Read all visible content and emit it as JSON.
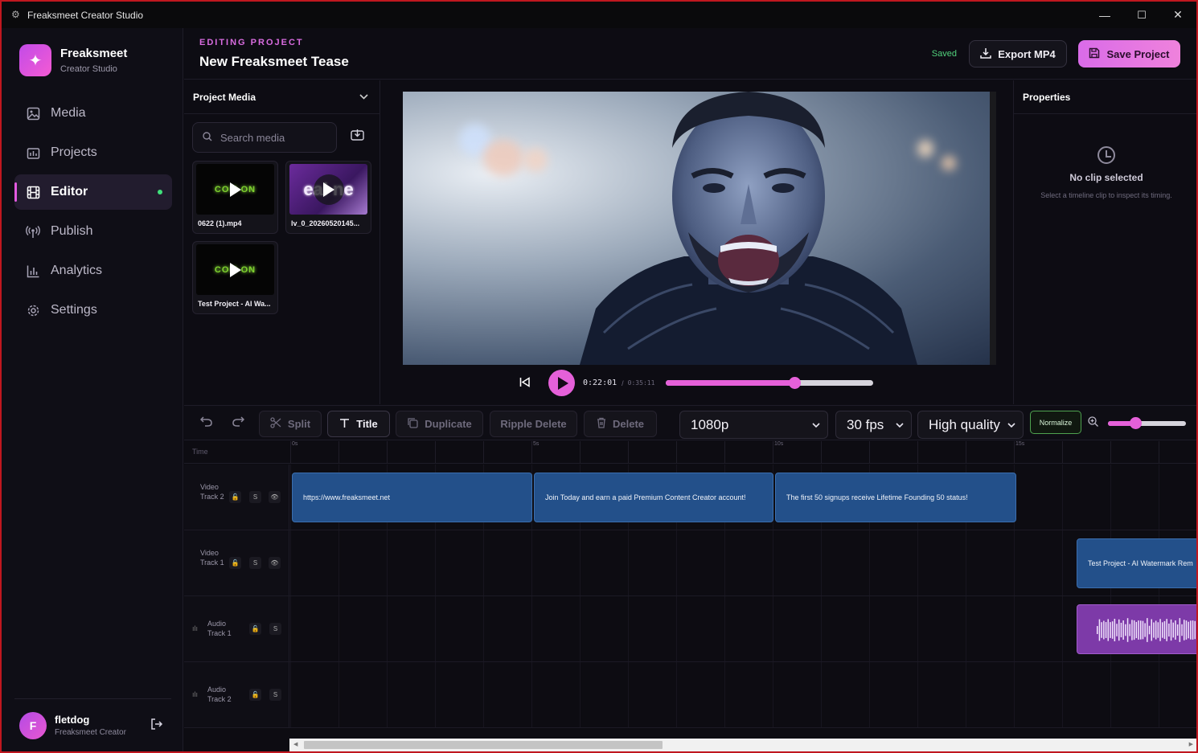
{
  "window": {
    "title": "Freaksmeet Creator Studio",
    "minimize": "—",
    "maximize": "☐",
    "close": "✕"
  },
  "brand": {
    "name": "Freaksmeet",
    "subtitle": "Creator Studio"
  },
  "nav": {
    "items": [
      {
        "label": "Media",
        "icon": "image-icon"
      },
      {
        "label": "Projects",
        "icon": "folder-icon"
      },
      {
        "label": "Editor",
        "icon": "film-icon",
        "active": true
      },
      {
        "label": "Publish",
        "icon": "broadcast-icon"
      },
      {
        "label": "Analytics",
        "icon": "bar-chart-icon"
      },
      {
        "label": "Settings",
        "icon": "gear-icon"
      }
    ]
  },
  "user": {
    "initial": "F",
    "name": "fletdog",
    "role": "Freaksmeet Creator"
  },
  "header": {
    "eyebrow": "EDITING PROJECT",
    "title": "New Freaksmeet Tease",
    "status": "Saved",
    "export_label": "Export MP4",
    "save_label": "Save Project"
  },
  "media_panel": {
    "title": "Project Media",
    "search_placeholder": "Search media",
    "items": [
      {
        "name": "0622 (1).mp4",
        "thumb_text": "COM  ON"
      },
      {
        "name": "lv_0_20260520145...",
        "thumb_text": "eal ne"
      },
      {
        "name": "Test Project - AI Wa...",
        "thumb_text": "COM  ON"
      }
    ]
  },
  "player": {
    "current_time": "0:22:01",
    "separator": "/",
    "total_time": "0:35:11",
    "progress": 0.62
  },
  "properties": {
    "title": "Properties",
    "empty_title": "No clip selected",
    "empty_hint": "Select a timeline clip to inspect its timing."
  },
  "toolbar": {
    "split": "Split",
    "title": "Title",
    "duplicate": "Duplicate",
    "ripple_delete": "Ripple Delete",
    "delete": "Delete",
    "resolution": "1080p",
    "fps": "30 fps",
    "quality": "High quality",
    "normalize": "Normalize",
    "zoom": 0.35
  },
  "timeline": {
    "time_label": "Time",
    "ticks": [
      "0s",
      "5s",
      "10s",
      "15s"
    ],
    "tracks": [
      {
        "name": "Video Track 2",
        "buttons": [
          "🔓",
          "S",
          "👁"
        ]
      },
      {
        "name": "Video Track 1",
        "buttons": [
          "🔓",
          "S",
          "👁"
        ]
      },
      {
        "name": "Audio Track 1",
        "buttons": [
          "🔓",
          "S"
        ]
      },
      {
        "name": "Audio Track 2",
        "buttons": [
          "🔓",
          "S"
        ]
      }
    ],
    "clips": {
      "v2": [
        "https://www.freaksmeet.net",
        "Join Today and earn a paid Premium Content Creator account!",
        "The first 50 signups receive Lifetime Founding 50 status!"
      ],
      "v1": [
        "Test Project - AI Watermark Rem"
      ]
    }
  }
}
